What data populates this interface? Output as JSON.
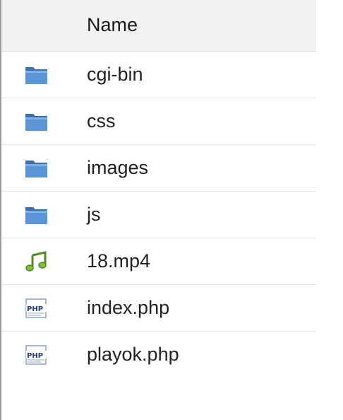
{
  "table": {
    "header": {
      "name_label": "Name"
    },
    "rows": [
      {
        "name": "cgi-bin",
        "type": "folder",
        "icon": "folder-icon"
      },
      {
        "name": "css",
        "type": "folder",
        "icon": "folder-icon"
      },
      {
        "name": "images",
        "type": "folder",
        "icon": "folder-icon"
      },
      {
        "name": "js",
        "type": "folder",
        "icon": "folder-icon"
      },
      {
        "name": "18.mp4",
        "type": "audio",
        "icon": "music-note-icon"
      },
      {
        "name": "index.php",
        "type": "php",
        "icon": "php-file-icon"
      },
      {
        "name": "playok.php",
        "type": "php",
        "icon": "php-file-icon"
      }
    ]
  },
  "colors": {
    "header_background": "#f2f2f2",
    "folder_icon": "#4f86c6",
    "music_icon": "#6aaa2a",
    "php_icon": "#2b4e8c",
    "row_border": "#e4e4e4"
  }
}
